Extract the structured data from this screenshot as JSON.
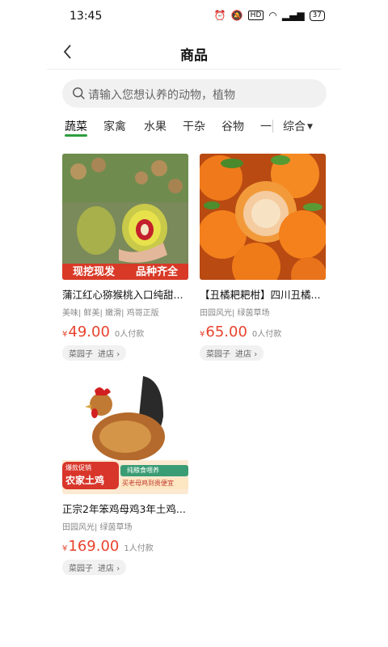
{
  "status_bar": {
    "time": "13:45",
    "battery": "37"
  },
  "header": {
    "title": "商品"
  },
  "search": {
    "placeholder": "请输入您想认养的动物，植物"
  },
  "tabs": [
    {
      "label": "蔬菜"
    },
    {
      "label": "家禽"
    },
    {
      "label": "水果"
    },
    {
      "label": "干杂"
    },
    {
      "label": "谷物"
    },
    {
      "label": "一"
    }
  ],
  "sort": {
    "label": "综合"
  },
  "products": [
    {
      "name": "蒲江红心猕猴桃入口纯甜...",
      "tags": "美味| 鲜美| 嫩滑| 鸡哥正版",
      "currency": "¥",
      "price": "49.00",
      "paid": "0人付款",
      "shop": "菜园子",
      "enter": "进店",
      "banner_left": "现挖现发",
      "banner_right": "品种齐全"
    },
    {
      "name": "【丑橘耙耙柑】四川丑橘...",
      "tags": "田园风光| 绿茵草场",
      "currency": "¥",
      "price": "65.00",
      "paid": "0人付款",
      "shop": "菜园子",
      "enter": "进店"
    },
    {
      "name": "正宗2年笨鸡母鸡3年土鸡...",
      "tags": "田园风光| 绿茵草场",
      "currency": "¥",
      "price": "169.00",
      "paid": "1人付款",
      "shop": "菜园子",
      "enter": "进店",
      "badge_small": "爆款促销",
      "badge_big": "农家土鸡",
      "green_tag": "纯粮食喂养",
      "promo": "买老母鸡到贵便宜"
    }
  ],
  "colors": {
    "accent": "#2e9e3d",
    "price": "#e8432e"
  }
}
